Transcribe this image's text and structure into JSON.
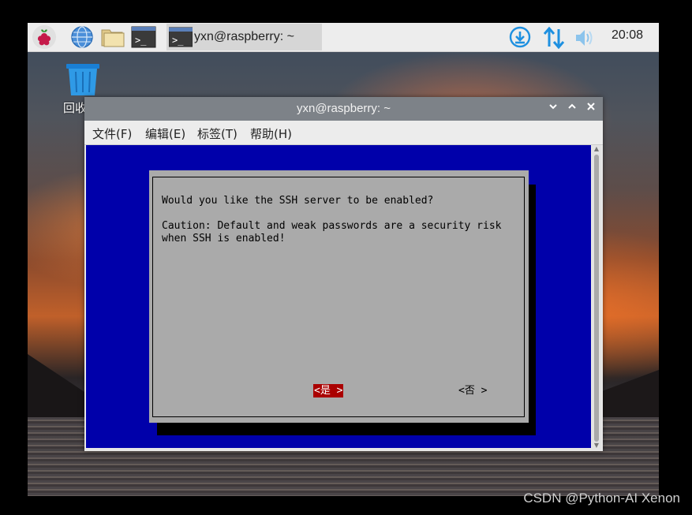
{
  "panel": {
    "window_button_label": "yxn@raspberry: ~",
    "clock": "20:08",
    "icons": [
      "raspberry-menu-icon",
      "web-browser-icon",
      "file-manager-icon",
      "terminal-icon",
      "download-icon",
      "network-updown-icon",
      "volume-icon"
    ]
  },
  "desktop": {
    "trash_label": "回收"
  },
  "window": {
    "title": "yxn@raspberry: ~",
    "menu": [
      "文件(F)",
      "编辑(E)",
      "标签(T)",
      "帮助(H)"
    ]
  },
  "dialog": {
    "question": "Would you like the SSH server to be enabled?",
    "caution_line1": "Caution: Default and weak passwords are a security risk",
    "caution_line2": "when SSH is enabled!",
    "yes_label": "<是 >",
    "no_label": "<否 >"
  },
  "colors": {
    "terminal_bg": "#0000aa",
    "dialog_bg": "#aaaaaa",
    "selected_button_bg": "#aa0000",
    "panel_bg": "#ededed",
    "titlebar_bg": "#7d8288",
    "accent_blue": "#1e90e0"
  },
  "watermark": "CSDN @Python-AI Xenon"
}
